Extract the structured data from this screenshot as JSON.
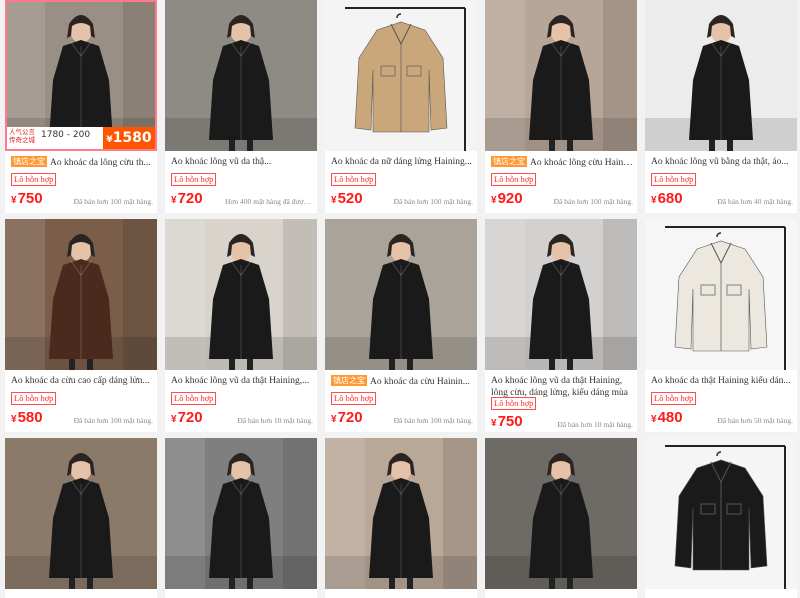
{
  "products": [
    {
      "title": "Ao khoác da lông cừu th...",
      "shop_badge": "镇店之宝",
      "tag": "Lô hỗn hợp",
      "currency": "¥",
      "price": "750",
      "sold": "Đã bán hơn 100 mặt hàng.",
      "coat": "black",
      "bg": "#9a8f84",
      "promo": {
        "line1": "人气公言 传奇之城",
        "range": "1780 - 200",
        "badge_price": "1580"
      }
    },
    {
      "title": "Ao khoác lông vũ da thậ...",
      "shop_badge": "",
      "tag": "Lô hỗn hợp",
      "currency": "¥",
      "price": "720",
      "sold": "Hơn 400 mặt hàng đã được bán.",
      "coat": "black",
      "bg": "#8e8a84"
    },
    {
      "title": "Ao khoác da nữ dáng lửng Haining...",
      "shop_badge": "",
      "tag": "Lô hỗn hợp",
      "currency": "¥",
      "price": "520",
      "sold": "Đã bán hơn 100 mặt hàng.",
      "coat": "tan",
      "bg": "#f4f4f4"
    },
    {
      "title": "Ao khoác lông cừu Hainin...",
      "shop_badge": "镇店之宝",
      "tag": "Lô hỗn hợp",
      "currency": "¥",
      "price": "920",
      "sold": "Đã bán hơn 100 mặt hàng.",
      "coat": "black",
      "bg": "#b7a597"
    },
    {
      "title": "Ao khoác lông vũ bằng da thật, áo...",
      "shop_badge": "",
      "tag": "Lô hỗn hợp",
      "currency": "¥",
      "price": "680",
      "sold": "Đã bán hơn 40 mặt hàng.",
      "coat": "black",
      "bg": "#ececec"
    },
    {
      "title": "Ao khoác da cừu cao cấp dáng lửn...",
      "shop_badge": "",
      "tag": "Lô hỗn hợp",
      "currency": "¥",
      "price": "580",
      "sold": "Đã bán hơn 100 mặt hàng.",
      "coat": "brown",
      "bg": "#7a5e4a"
    },
    {
      "title": "Ao khoác lông vũ da thật Haining,...",
      "shop_badge": "",
      "tag": "Lô hỗn hợp",
      "currency": "¥",
      "price": "720",
      "sold": "Đã bán hơn 10 mặt hàng.",
      "coat": "black",
      "bg": "#d8d4cc"
    },
    {
      "title": "Ao khoác da cừu Hainin...",
      "shop_badge": "镇店之宝",
      "tag": "Lô hỗn hợp",
      "currency": "¥",
      "price": "720",
      "sold": "Đã bán hơn 100 mặt hàng.",
      "coat": "black",
      "bg": "#a9a39a"
    },
    {
      "title": "Ao khoác lông vũ da thật Haining, lông cừu, dáng lửng, kiểu dáng mùa ...",
      "shop_badge": "",
      "tag": "Lô hỗn hợp",
      "currency": "¥",
      "price": "750",
      "sold": "Đã bán hơn 10 mặt hàng.",
      "coat": "black",
      "bg": "#d3d1cf",
      "twoline": true
    },
    {
      "title": "Ao khoác da thật Haining kiểu dán...",
      "shop_badge": "",
      "tag": "Lô hỗn hợp",
      "currency": "¥",
      "price": "480",
      "sold": "Đã bán hơn 50 mặt hàng.",
      "coat": "white",
      "bg": "#f6f6f6"
    },
    {
      "coat": "black",
      "bg": "#8b7a6a"
    },
    {
      "coat": "black",
      "bg": "#7f7f7f"
    },
    {
      "coat": "black",
      "bg": "#b9a898"
    },
    {
      "coat": "black",
      "bg": "#6e6a66"
    },
    {
      "coat": "black",
      "bg": "#f5f5f5"
    }
  ],
  "colors": {
    "price": "#ff1a1a",
    "tag_border": "#ff4d4d",
    "shop_badge": "#ff9a33",
    "promo_badge": "#ff5500"
  }
}
